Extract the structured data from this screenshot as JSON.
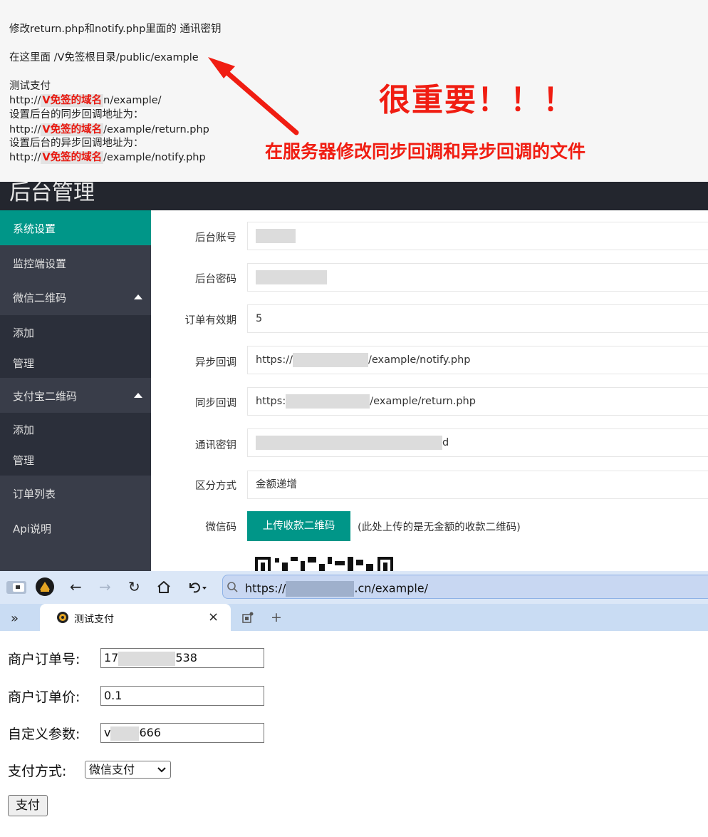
{
  "instructions": {
    "line1": "修改return.php和notify.php里面的 通讯密钥",
    "line2": "在这里面 /V免签根目录/public/example",
    "line3": "测试支付",
    "url1_prefix": "http://",
    "url1_suffix": "n/example/",
    "line5": "设置后台的同步回调地址为：",
    "url2_prefix": "http://",
    "url2_suffix": "/example/return.php",
    "line7": "设置后台的异步回调地址为：",
    "url3_prefix": "http://",
    "url3_suffix": "/example/notify.php",
    "mask_text": "V免签的域名",
    "important": "很重要！！！",
    "caption": "在服务器修改同步回调和异步回调的文件"
  },
  "admin": {
    "title": "后台管理",
    "sidebar": {
      "items": [
        {
          "label": "系统设置"
        },
        {
          "label": "监控端设置"
        },
        {
          "label": "微信二维码"
        },
        {
          "label": "添加"
        },
        {
          "label": "管理"
        },
        {
          "label": "支付宝二维码"
        },
        {
          "label": "添加"
        },
        {
          "label": "管理"
        },
        {
          "label": "订单列表"
        },
        {
          "label": "Api说明"
        }
      ]
    },
    "form": {
      "account_label": "后台账号",
      "password_label": "后台密码",
      "expire_label": "订单有效期",
      "expire_value": "5",
      "notify_label": "异步回调",
      "notify_prefix": "https://",
      "notify_suffix": "/example/notify.php",
      "return_label": "同步回调",
      "return_prefix": "https:",
      "return_suffix": "/example/return.php",
      "key_label": "通讯密钥",
      "key_suffix": "d",
      "mode_label": "区分方式",
      "mode_value": "金额递增",
      "wechat_label": "微信码",
      "upload_label": "上传收款二维码",
      "upload_note": "(此处上传的是无金额的收款二维码)"
    }
  },
  "browser": {
    "url_prefix": "https://",
    "url_suffix": ".cn/example/",
    "tab_title": "测试支付",
    "close_glyph": "×",
    "new_tab_glyph": "+",
    "more_glyph": "»"
  },
  "payment": {
    "order_no_label": "商户订单号:",
    "order_no_prefix": "17",
    "order_no_suffix": "538",
    "price_label": "商户订单价:",
    "price_value": "0.1",
    "param_label": "自定义参数:",
    "param_prefix": "v",
    "param_suffix": "666",
    "method_label": "支付方式:",
    "method_value": "微信支付",
    "pay_button": "支付"
  }
}
